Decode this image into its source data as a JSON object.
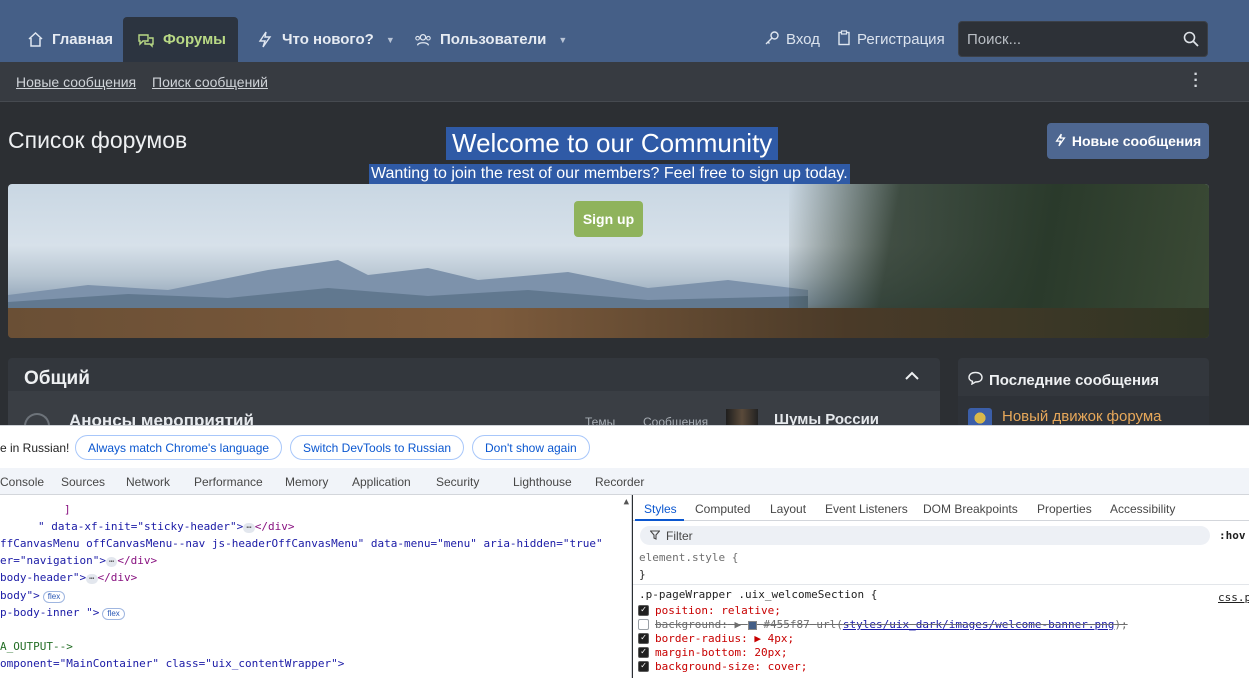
{
  "forum": {
    "nav": {
      "home": "Главная",
      "forums": "Форумы",
      "whats_new": "Что нового?",
      "members": "Пользователи",
      "login": "Вход",
      "register": "Регистрация",
      "search_placeholder": "Поиск..."
    },
    "subnav": {
      "new_posts": "Новые сообщения",
      "search_posts": "Поиск сообщений"
    },
    "page_title": "Список форумов",
    "new_posts_button": "Новые сообщения",
    "welcome": {
      "title": "Welcome to our Community",
      "subtitle": "Wanting to join the rest of our members? Feel free to sign up today.",
      "signup": "Sign up"
    },
    "section": {
      "title": "Общий",
      "forum_name": "Анонсы мероприятий",
      "col_threads": "Темы",
      "col_messages": "Сообщения",
      "last_post_title": "Шумы России участв..."
    },
    "sidebar": {
      "title": "Последние сообщения",
      "item": "Новый движок форума"
    },
    "colors": {
      "nav_bg": "#455f87",
      "active_accent": "#b9d985",
      "signup_bg": "#8fb35c",
      "sidebar_link": "#e7a85a"
    }
  },
  "devtools": {
    "infobar": {
      "message": "e in Russian!",
      "btn_match": "Always match Chrome's language",
      "btn_switch": "Switch DevTools to Russian",
      "btn_dont_show": "Don't show again"
    },
    "tabs": [
      "Console",
      "Sources",
      "Network",
      "Performance",
      "Memory",
      "Application",
      "Security",
      "Lighthouse",
      "Recorder"
    ],
    "elements": {
      "l1": "]",
      "l2_a": "\" data-xf-init=\"sticky-header\">",
      "l2_b": "</div>",
      "l3": "ffCanvasMenu offCanvasMenu--nav js-headerOffCanvasMenu\" data-menu=\"menu\" aria-hidden=\"true\"",
      "l4_a": "er=\"navigation\">",
      "l4_b": "</div>",
      "l5_a": "body-header\">",
      "l5_b": "</div>",
      "l6": "body\">",
      "l7": "p-body-inner \">",
      "l8": "A_OUTPUT-->",
      "l9": "omponent=\"MainContainer\" class=\"uix_contentWrapper\">",
      "badge_flex": "flex",
      "ellipsis": "⋯"
    },
    "styles": {
      "tabs": [
        "Styles",
        "Computed",
        "Layout",
        "Event Listeners",
        "DOM Breakpoints",
        "Properties",
        "Accessibility"
      ],
      "filter": "Filter",
      "hov": ":hov",
      "element_style_open": "element.style {",
      "element_style_close": "}",
      "selector": ".p-pageWrapper .uix_welcomeSection {",
      "source": "css.p",
      "props": {
        "position": "position: relative;",
        "background_name": "background:",
        "background_color": "#455f87",
        "background_url_prefix": "url(",
        "background_url": "styles/uix_dark/images/welcome-banner.png",
        "background_url_suffix": ");",
        "border_radius": "border-radius: ▶ 4px;",
        "margin_bottom": "margin-bottom: 20px;",
        "background_size": "background-size: cover;"
      }
    }
  }
}
